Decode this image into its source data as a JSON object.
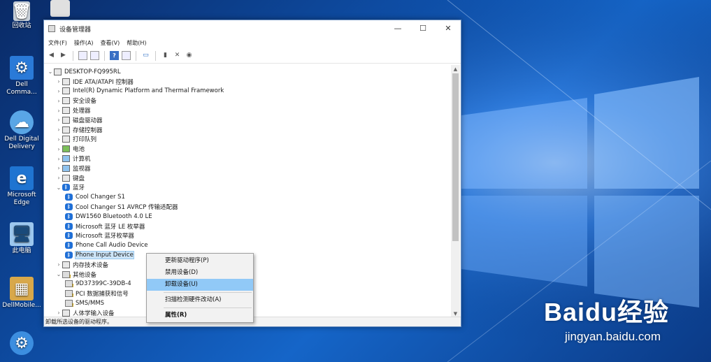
{
  "desktop": {
    "icons": [
      {
        "label": "回收站"
      },
      {
        "label": "Dell Comma..."
      },
      {
        "label": "Dell Digital Delivery"
      },
      {
        "label": "Microsoft Edge"
      },
      {
        "label": "此电脑"
      },
      {
        "label": "DellMobile..."
      }
    ],
    "watermark": {
      "brand": "Baidu经验",
      "url": "jingyan.baidu.com"
    }
  },
  "window": {
    "title": "设备管理器",
    "controls": {
      "minimize": "—",
      "maximize": "☐",
      "close": "✕"
    },
    "menu": [
      "文件(F)",
      "操作(A)",
      "查看(V)",
      "帮助(H)"
    ],
    "status": "卸载所选设备的驱动程序。"
  },
  "tree": {
    "root": "DESKTOP-FQ995RL",
    "categories": [
      "IDE ATA/ATAPI 控制器",
      "Intel(R) Dynamic Platform and Thermal Framework",
      "安全设备",
      "处理器",
      "磁盘驱动器",
      "存储控制器",
      "打印队列",
      "电池",
      "计算机",
      "监视器",
      "键盘",
      "蓝牙"
    ],
    "bluetooth_children": [
      "Cool Changer S1",
      "Cool Changer S1 AVRCP 传输适配器",
      "DW1560 Bluetooth 4.0 LE",
      "Microsoft 蓝牙 LE 枚举器",
      "Microsoft 蓝牙枚举器",
      "Phone Call Audio Device",
      "Phone Input Device"
    ],
    "after": [
      "内存技术设备",
      "其他设备"
    ],
    "other_children": [
      "9D37399C-39DB-4",
      "PCI 数据捕获和信号",
      "SMS/MMS"
    ],
    "last": "人体学输入设备"
  },
  "context_menu": {
    "items": [
      "更新驱动程序(P)",
      "禁用设备(D)",
      "卸载设备(U)",
      "扫描检测硬件改动(A)",
      "属性(R)"
    ]
  }
}
